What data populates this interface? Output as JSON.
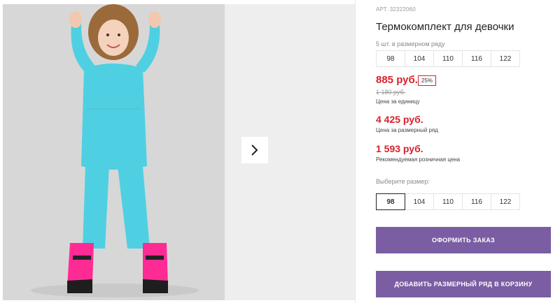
{
  "product": {
    "sku": "АРТ. 32322060",
    "title": "Термокомплект для девочки",
    "range_label": "5 шт. в размерном ряду",
    "range_sizes": [
      "98",
      "104",
      "110",
      "116",
      "122"
    ],
    "price": "885 руб.",
    "discount": "25%",
    "old_price": "1 180 руб.",
    "unit_label": "Цена за единицу",
    "range_price": "4 425 руб.",
    "range_price_label": "Цена за размерный ряд",
    "retail_price": "1 593 руб.",
    "retail_label": "Рекомендуемая розничная цена",
    "choose_label": "Выберите размер:",
    "select_sizes": [
      "98",
      "104",
      "110",
      "116",
      "122"
    ],
    "selected_size": "98"
  },
  "buttons": {
    "order": "ОФОРМИТЬ ЗАКАЗ",
    "add_to_cart": "ДОБАВИТЬ РАЗМЕРНЫЙ РЯД В КОРЗИНУ"
  },
  "colors": {
    "accent": "#7a5da3",
    "price": "#d9202b",
    "outfit": "#4fd0e2",
    "boots": "#ff2b95"
  },
  "icons": {
    "gallery_next": "chevron-right-icon"
  }
}
